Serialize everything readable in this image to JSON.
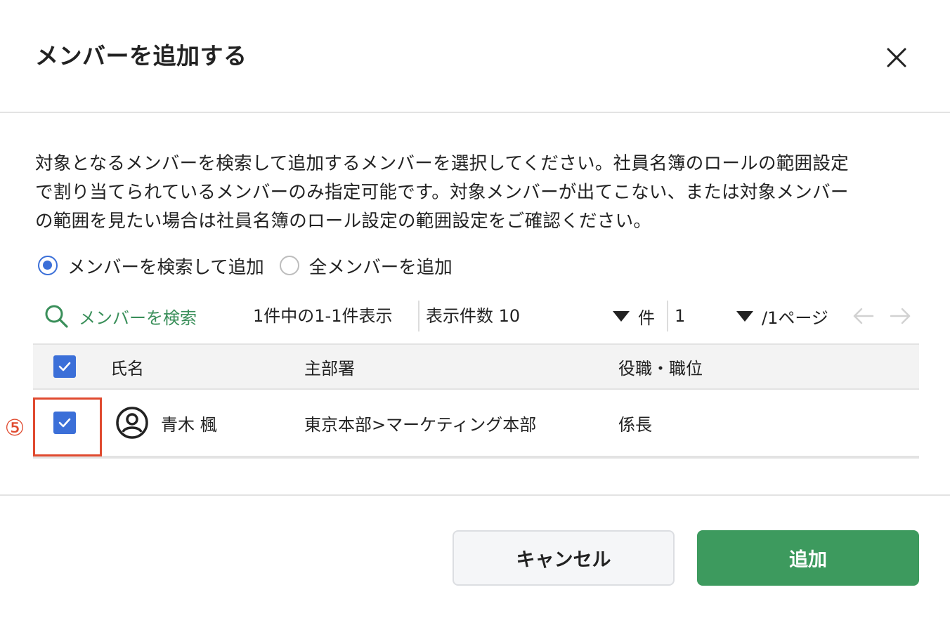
{
  "dialog": {
    "title": "メンバーを追加する",
    "close_icon": "close-icon"
  },
  "description": {
    "lines": [
      "対象となるメンバーを検索して追加するメンバーを選択してください。社員名簿のロールの範囲設定",
      "で割り当てられているメンバーのみ指定可能です。対象メンバーが出てこない、または対象メンバー",
      "の範囲を見たい場合は社員名簿のロール設定の範囲設定をご確認ください。"
    ]
  },
  "mode": {
    "options": [
      {
        "label": "メンバーを検索して追加",
        "selected": true
      },
      {
        "label": "全メンバーを追加",
        "selected": false
      }
    ]
  },
  "toolbar": {
    "search_label": "メンバーを検索",
    "count_text": "1件中の1-1件表示",
    "per_page_text": "表示件数 10",
    "per_page_unit": "件",
    "page_value": "1",
    "page_total": "/1ページ",
    "prev_icon": "arrow-left-icon",
    "next_icon": "arrow-right-icon"
  },
  "table": {
    "columns": [
      "氏名",
      "主部署",
      "役職・職位"
    ],
    "header_checked": true,
    "rows": [
      {
        "checked": true,
        "name": "青木 楓",
        "department": "東京本部>マーケティング本部",
        "position": "係長"
      }
    ]
  },
  "annotation": {
    "step_marker": "⑤",
    "highlight_color": "#e04a2f"
  },
  "footer": {
    "cancel_label": "キャンセル",
    "add_label": "追加"
  },
  "colors": {
    "accent_blue": "#3b6fd8",
    "accent_green": "#3d9a5e",
    "link_green": "#3a8f5a"
  }
}
